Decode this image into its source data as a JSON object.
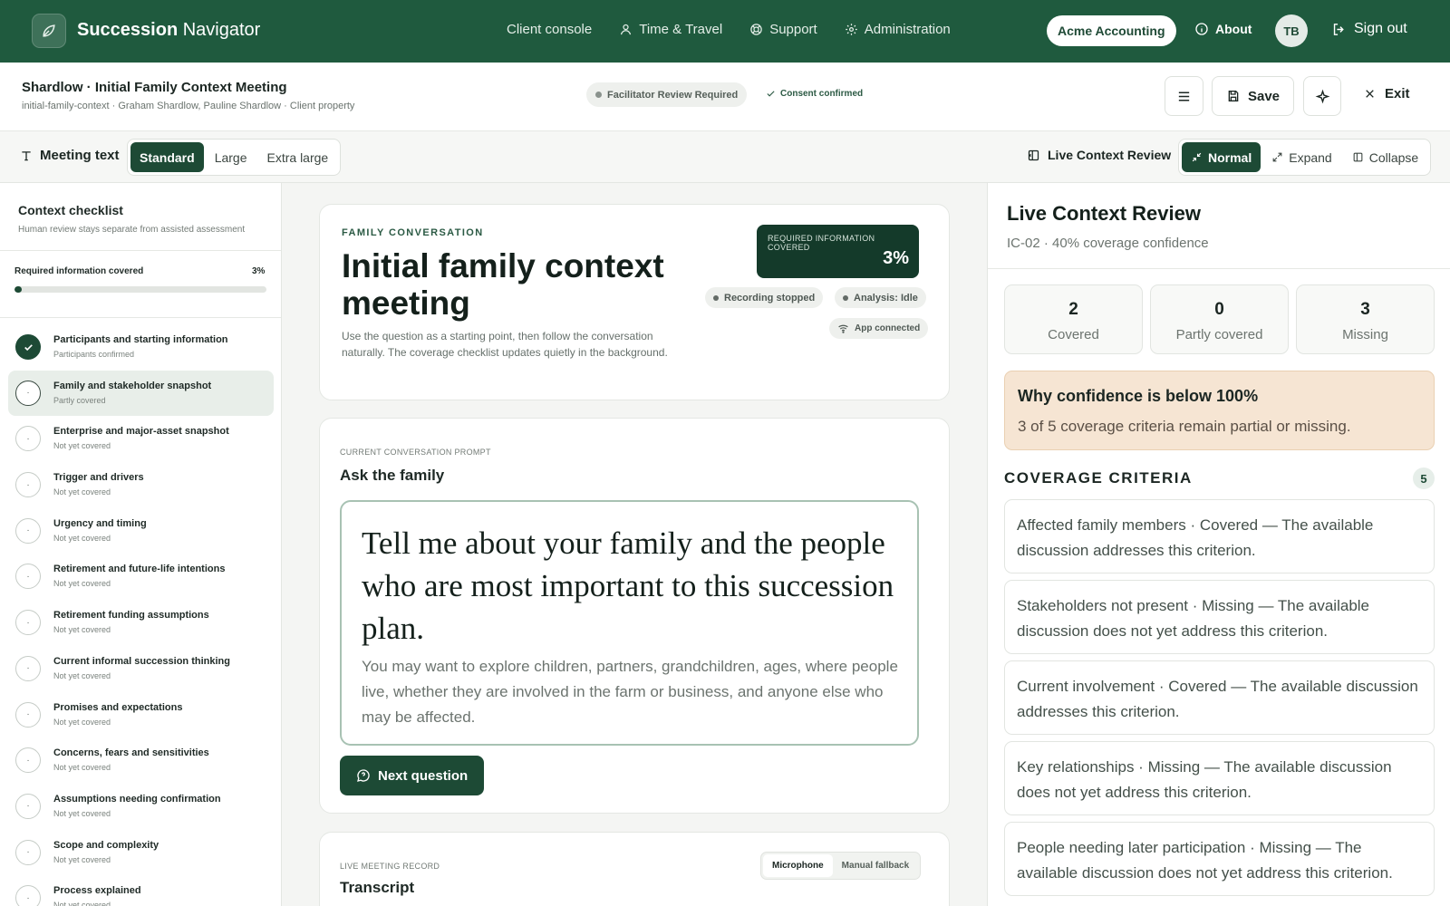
{
  "topbar": {
    "brand_bold": "Succession",
    "brand_rest": " Navigator",
    "nav": [
      {
        "label": "Client console",
        "icon": ""
      },
      {
        "label": "Time & Travel",
        "icon": "user-icon"
      },
      {
        "label": "Support",
        "icon": "lifebuoy-icon"
      },
      {
        "label": "Administration",
        "icon": "gear-icon"
      }
    ],
    "org": "Acme Accounting",
    "about": "About",
    "avatar": "TB",
    "signout": "Sign out"
  },
  "meeting": {
    "title": "Shardlow · Initial Family Context Meeting",
    "subtitle": "initial-family-context · Graham Shardlow, Pauline Shardlow · Client property",
    "review_status": "Facilitator Review Required",
    "consent": "Consent confirmed",
    "save": "Save",
    "exit": "Exit"
  },
  "toolbar": {
    "meeting_text": "Meeting text",
    "sizes": [
      "Standard",
      "Large",
      "Extra large"
    ],
    "active_size": "Standard",
    "live_context_review": "Live Context Review",
    "view_modes": [
      "Normal",
      "Expand",
      "Collapse"
    ],
    "active_view": "Normal"
  },
  "sidebar": {
    "title": "Context checklist",
    "subtitle": "Human review stays separate from assisted assessment",
    "progress_label": "Required information covered",
    "progress_value": "3%",
    "progress_fraction": 0.03,
    "items": [
      {
        "label": "Participants and starting information",
        "status": "Participants confirmed",
        "state": "done"
      },
      {
        "label": "Family and stakeholder snapshot",
        "status": "Partly covered",
        "state": "active"
      },
      {
        "label": "Enterprise and major-asset snapshot",
        "status": "Not yet covered",
        "state": "todo"
      },
      {
        "label": "Trigger and drivers",
        "status": "Not yet covered",
        "state": "todo"
      },
      {
        "label": "Urgency and timing",
        "status": "Not yet covered",
        "state": "todo"
      },
      {
        "label": "Retirement and future-life intentions",
        "status": "Not yet covered",
        "state": "todo"
      },
      {
        "label": "Retirement funding assumptions",
        "status": "Not yet covered",
        "state": "todo"
      },
      {
        "label": "Current informal succession thinking",
        "status": "Not yet covered",
        "state": "todo"
      },
      {
        "label": "Promises and expectations",
        "status": "Not yet covered",
        "state": "todo"
      },
      {
        "label": "Concerns, fears and sensitivities",
        "status": "Not yet covered",
        "state": "todo"
      },
      {
        "label": "Assumptions needing confirmation",
        "status": "Not yet covered",
        "state": "todo"
      },
      {
        "label": "Scope and complexity",
        "status": "Not yet covered",
        "state": "todo"
      },
      {
        "label": "Process explained",
        "status": "Not yet covered",
        "state": "todo"
      }
    ]
  },
  "hero": {
    "eyebrow": "FAMILY CONVERSATION",
    "title": "Initial family context meeting",
    "description": "Use the question as a starting point, then follow the conversation naturally. The coverage checklist updates quietly in the background.",
    "req_label": "REQUIRED INFORMATION COVERED",
    "req_value": "3%",
    "recording": "Recording stopped",
    "analysis": "Analysis: Idle",
    "app": "App connected"
  },
  "prompt": {
    "eyebrow": "CURRENT CONVERSATION PROMPT",
    "heading": "Ask the family",
    "question": "Tell me about your family and the people who are most important to this succession plan.",
    "hint": "You may want to explore children, partners, grandchildren, ages, where people live, whether they are involved in the farm or business, and anyone else who may be affected.",
    "next": "Next question"
  },
  "transcript": {
    "eyebrow": "LIVE MEETING RECORD",
    "heading": "Transcript",
    "modes": [
      "Microphone",
      "Manual fallback"
    ],
    "active_mode": "Microphone"
  },
  "review": {
    "title": "Live Context Review",
    "subtitle": "IC-02 · 40% coverage confidence",
    "stats": [
      {
        "num": "2",
        "label": "Covered"
      },
      {
        "num": "0",
        "label": "Partly covered"
      },
      {
        "num": "3",
        "label": "Missing"
      }
    ],
    "why_heading": "Why confidence is below 100%",
    "why_text": "3 of 5 coverage criteria remain partial or missing.",
    "criteria_heading": "COVERAGE CRITERIA",
    "criteria_count": "5",
    "criteria": [
      "Affected family members · Covered — The available discussion addresses this criterion.",
      "Stakeholders not present · Missing — The available discussion does not yet address this criterion.",
      "Current involvement · Covered — The available discussion addresses this criterion.",
      "Key relationships · Missing — The available discussion does not yet address this criterion.",
      "People needing later participation · Missing — The available discussion does not yet address this criterion."
    ]
  },
  "colors": {
    "brand_green": "#1f5a3e",
    "dark_green": "#1d4a35",
    "warning_bg": "#f6e5d3"
  }
}
